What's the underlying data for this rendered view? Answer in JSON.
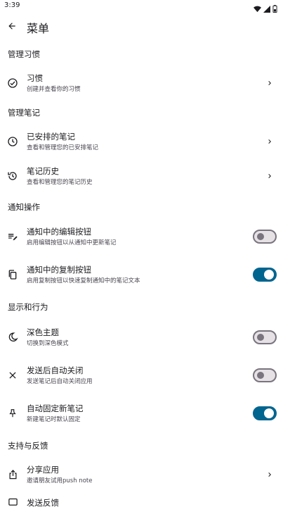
{
  "status": {
    "time": "3:39"
  },
  "header": {
    "title": "菜单"
  },
  "sections": {
    "habits": "管理习惯",
    "notes": "管理笔记",
    "notify": "通知操作",
    "display": "显示和行为",
    "support": "支持与反馈"
  },
  "items": {
    "habits": {
      "title": "习惯",
      "subtitle": "创建并查看你的习惯"
    },
    "scheduled": {
      "title": "已安排的笔记",
      "subtitle": "查看和管理您的已安排笔记"
    },
    "history": {
      "title": "笔记历史",
      "subtitle": "查看和管理您的笔记历史"
    },
    "edit_btn": {
      "title": "通知中的编辑按钮",
      "subtitle": "启用编辑按钮以从通知中更新笔记",
      "enabled": false
    },
    "copy_btn": {
      "title": "通知中的复制按钮",
      "subtitle": "启用复制按钮以快速复制通知中的笔记文本",
      "enabled": true
    },
    "dark": {
      "title": "深色主题",
      "subtitle": "切换到深色模式",
      "enabled": false
    },
    "auto_close": {
      "title": "发送后自动关闭",
      "subtitle": "发送笔记后自动关闭应用",
      "enabled": false
    },
    "auto_pin": {
      "title": "自动固定新笔记",
      "subtitle": "新建笔记时默认固定",
      "enabled": true
    },
    "share": {
      "title": "分享应用",
      "subtitle": "邀请朋友试用push note"
    },
    "feedback": {
      "title": "发送反馈"
    }
  },
  "colors": {
    "accent": "#00658f",
    "text": "#1c1b1f",
    "subtext": "#49454f",
    "switch_off_border": "#79747e"
  }
}
